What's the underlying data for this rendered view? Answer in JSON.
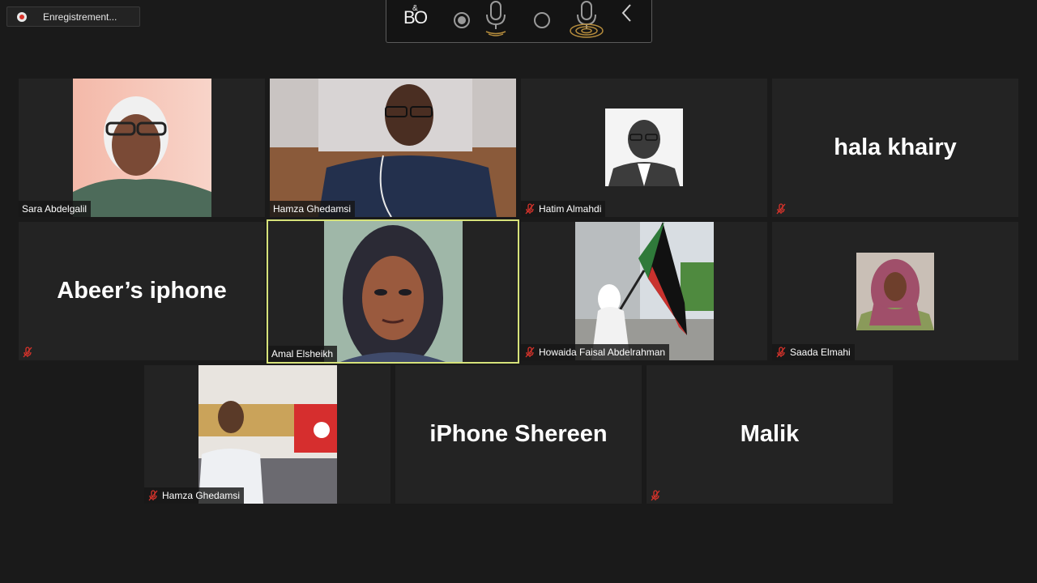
{
  "recording": {
    "label": "Enregistrement..."
  },
  "toolbar": {
    "logo_text": "B&O"
  },
  "tiles": [
    {
      "name": "Sara Abdelgalil",
      "muted": false,
      "type": "video",
      "big_name": ""
    },
    {
      "name": "Hamza Ghedamsi",
      "muted": false,
      "type": "video",
      "big_name": ""
    },
    {
      "name": "Hatim Almahdi",
      "muted": true,
      "type": "avatar",
      "big_name": ""
    },
    {
      "name": "",
      "muted": true,
      "type": "name",
      "big_name": "hala khairy"
    },
    {
      "name": "",
      "muted": true,
      "type": "name",
      "big_name": "Abeer’s iphone"
    },
    {
      "name": "Amal Elsheikh",
      "muted": false,
      "type": "video",
      "big_name": ""
    },
    {
      "name": "Howaida Faisal Abdelrahman",
      "muted": true,
      "type": "video",
      "big_name": ""
    },
    {
      "name": "Saada Elmahi",
      "muted": true,
      "type": "avatar",
      "big_name": ""
    },
    {
      "name": "Hamza Ghedamsi",
      "muted": true,
      "type": "video",
      "big_name": ""
    },
    {
      "name": "",
      "muted": false,
      "type": "name",
      "big_name": "iPhone Shereen"
    },
    {
      "name": "",
      "muted": true,
      "type": "name",
      "big_name": "Malik"
    }
  ],
  "colors": {
    "background": "#1a1a1a",
    "tile": "#232323",
    "active_outline": "#d6e27a",
    "mute_red": "#d8332b"
  }
}
